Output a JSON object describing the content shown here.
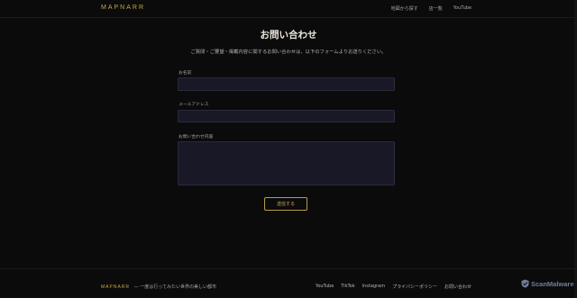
{
  "header": {
    "brand": "MAPNARR",
    "nav": [
      {
        "label": "地図から探す"
      },
      {
        "label": "店一覧"
      },
      {
        "label": "YouTube"
      }
    ]
  },
  "main": {
    "title": "お問い合わせ",
    "subtitle": "ご質問・ご要望・掲載内容に関するお問い合わせは、以下のフォームよりお送りください。",
    "fields": {
      "name_label": "お名前",
      "name_value": "",
      "email_label": "メールアドレス",
      "email_value": "",
      "message_label": "お問い合わせ内容",
      "message_value": ""
    },
    "submit_label": "送信する"
  },
  "footer": {
    "brand": "MAPNARR",
    "tagline": "— 一度は行ってみたい世界の美しい都市",
    "links": [
      {
        "label": "YouTube"
      },
      {
        "label": "TikTok"
      },
      {
        "label": "Instagram"
      },
      {
        "label": "プライバシーポリシー"
      },
      {
        "label": "お問い合わせ"
      }
    ]
  },
  "watermark": {
    "text": "ScanMalware",
    "icon": "shield-logo-icon"
  },
  "colors": {
    "accent": "#c9a64a",
    "background": "#0b0b0c",
    "field_bg": "#181826"
  }
}
